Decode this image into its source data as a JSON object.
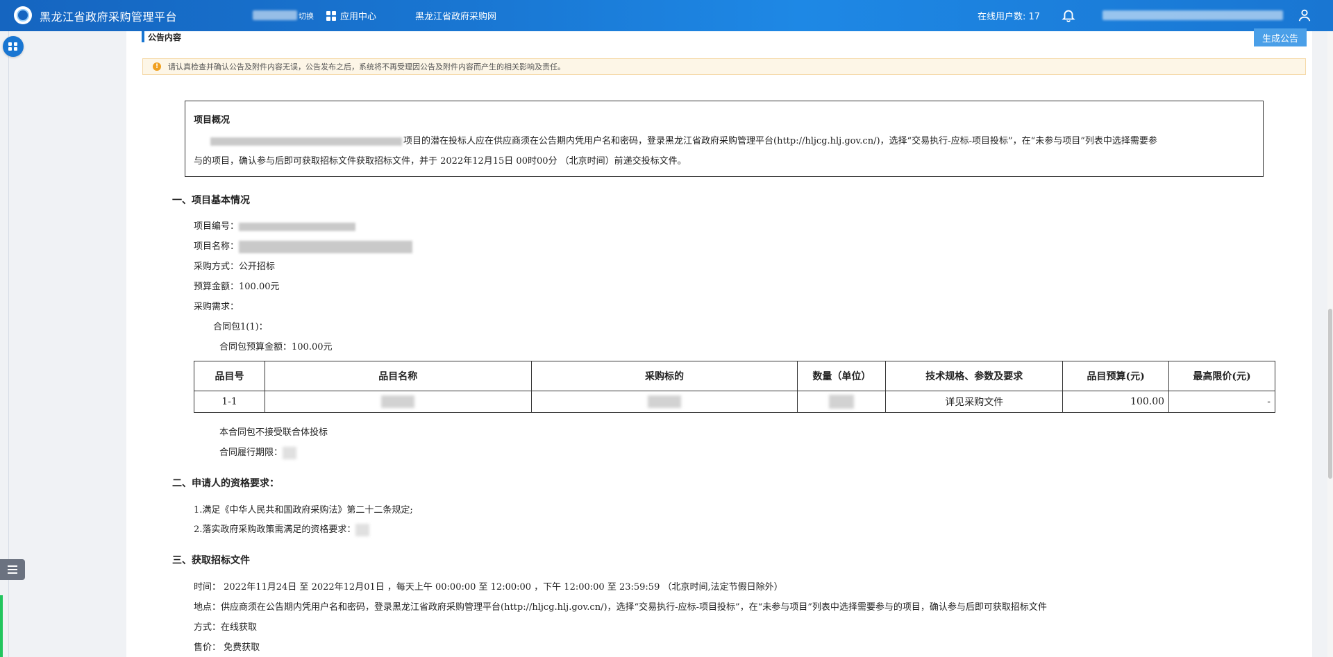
{
  "topbar": {
    "title": "黑龙江省政府采购管理平台",
    "switch_label": "切换",
    "apps_label": "应用中心",
    "site_label": "黑龙江省政府采购网",
    "online_users": "在线用户数: 17"
  },
  "panel": {
    "section_title": "公告内容",
    "generate_button": "生成公告",
    "notice_icon": "!",
    "notice": "请认真检查并确认公告及附件内容无误，公告发布之后，系统将不再受理因公告及附件内容而产生的相关影响及责任。"
  },
  "overview": {
    "title": "项目概况",
    "line1": "项目的潜在投标人应在供应商须在公告期内凭用户名和密码，登录黑龙江省政府采购管理平台(http://hljcg.hlj.gov.cn/)，选择“交易执行-应标-项目投标”，在“未参与项目”列表中选择需要参",
    "line2": "与的项目，确认参与后即可获取招标文件获取招标文件，并于 2022年12月15日 00时00分 （北京时间）前递交投标文件。"
  },
  "section1": {
    "heading": "一、项目基本情况",
    "project_no_label": "项目编号：",
    "project_name_label": "项目名称：",
    "method": "采购方式：公开招标",
    "budget": "预算金额：100.00元",
    "demand_label": "采购需求：",
    "package": "合同包1(1)：",
    "package_budget": "合同包预算金额：100.00元",
    "no_consortium": "本合同包不接受联合体投标",
    "period_label": "合同履行期限："
  },
  "table": {
    "headers": [
      "品目号",
      "品目名称",
      "采购标的",
      "数量（单位）",
      "技术规格、参数及要求",
      "品目预算(元)",
      "最高限价(元)"
    ],
    "row": {
      "no": "1-1",
      "spec": "详见采购文件",
      "budget": "100.00",
      "max_price": "-"
    }
  },
  "section2": {
    "heading": "二、申请人的资格要求：",
    "item1": "1.满足《中华人民共和国政府采购法》第二十二条规定;",
    "item2": "2.落实政府采购政策需满足的资格要求："
  },
  "section3": {
    "heading": "三、获取招标文件",
    "time": "时间： 2022年11月24日 至 2022年12月01日 ，每天上午 00:00:00 至 12:00:00 ，下午 12:00:00 至 23:59:59 （北京时间,法定节假日除外）",
    "place": "地点：供应商须在公告期内凭用户名和密码，登录黑龙江省政府采购管理平台(http://hljcg.hlj.gov.cn/)，选择“交易执行-应标-项目投标”，在“未参与项目”列表中选择需要参与的项目，确认参与后即可获取招标文件",
    "method": "方式：在线获取",
    "price": "售价： 免费获取"
  }
}
